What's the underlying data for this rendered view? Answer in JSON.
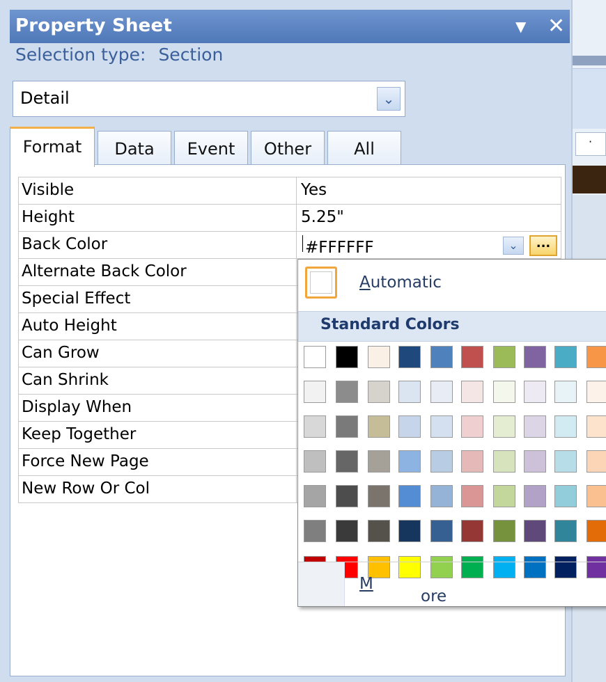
{
  "pane": {
    "title": "Property Sheet",
    "menu_glyph": "▼",
    "close_glyph": "✕",
    "selection_label": "Selection type:",
    "selection_value": "Section",
    "object_combo": {
      "value": "Detail",
      "button_glyph": "⌄"
    }
  },
  "tabs": [
    {
      "label": "Format",
      "active": true
    },
    {
      "label": "Data",
      "active": false
    },
    {
      "label": "Event",
      "active": false
    },
    {
      "label": "Other",
      "active": false
    },
    {
      "label": "All",
      "active": false
    }
  ],
  "properties": [
    {
      "name": "Visible",
      "value": "Yes"
    },
    {
      "name": "Height",
      "value": "5.25\""
    },
    {
      "name": "Back Color",
      "value": "#FFFFFF"
    },
    {
      "name": "Alternate Back Color",
      "value": ""
    },
    {
      "name": "Special Effect",
      "value": ""
    },
    {
      "name": "Auto Height",
      "value": ""
    },
    {
      "name": "Can Grow",
      "value": ""
    },
    {
      "name": "Can Shrink",
      "value": ""
    },
    {
      "name": "Display When",
      "value": ""
    },
    {
      "name": "Keep Together",
      "value": ""
    },
    {
      "name": "Force New Page",
      "value": ""
    },
    {
      "name": "New Row Or Col",
      "value": ""
    }
  ],
  "color_picker": {
    "automatic_label_accel": "A",
    "automatic_label_rest": "utomatic",
    "standard_header": "Standard Colors",
    "more_label_accel": "M",
    "more_label_rest": "ore Colors...",
    "ellipsis_glyph": "...",
    "dropdown_glyph": "⌄",
    "swatch_rows": [
      [
        "#ffffff",
        "#000000",
        "#fbf0e6",
        "#1f497d",
        "#4f81bd",
        "#c0504d",
        "#9bbb59",
        "#8064a2",
        "#4bacc6",
        "#f79646"
      ],
      [
        "#f2f2f2",
        "#8c8c8c",
        "#d6d3cc",
        "#dbe5f1",
        "#e7ecf5",
        "#f5e6e6",
        "#f4f7ec",
        "#eeeaf3",
        "#e8f3f7",
        "#fdf2e9"
      ],
      [
        "#d8d8d8",
        "#7a7a7a",
        "#c4bd97",
        "#c6d5ea",
        "#d4e0ef",
        "#efcfcf",
        "#e4ecd2",
        "#dcd5e6",
        "#d2eaf1",
        "#fde2cc"
      ],
      [
        "#bfbfbf",
        "#666666",
        "#a5a098",
        "#8db3e2",
        "#b8cce4",
        "#e5b9b7",
        "#d7e3bc",
        "#ccc1d9",
        "#b7dde8",
        "#fbd5b5"
      ],
      [
        "#a5a5a5",
        "#4d4d4d",
        "#7a746c",
        "#548dd4",
        "#95b3d7",
        "#d99694",
        "#c3d69b",
        "#b2a2c7",
        "#92cddc",
        "#fac08f"
      ],
      [
        "#7f7f7f",
        "#3a3a3a",
        "#55514b",
        "#17365d",
        "#366092",
        "#953734",
        "#76923c",
        "#5f497a",
        "#31859b",
        "#e36c09"
      ],
      [
        "#c00000",
        "#ff0000",
        "#ffc000",
        "#ffff00",
        "#92d050",
        "#00b050",
        "#00b0f0",
        "#0070c0",
        "#002060",
        "#7030a0"
      ]
    ]
  }
}
